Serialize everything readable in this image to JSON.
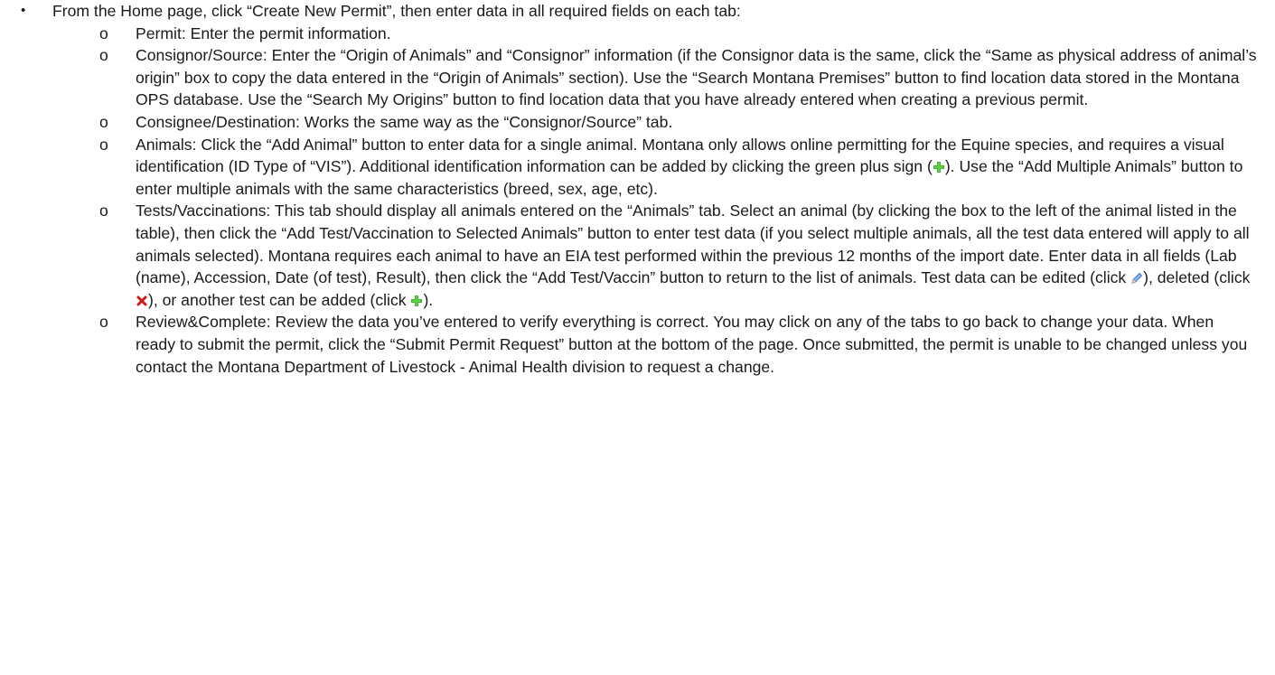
{
  "bullet": {
    "marker": "•",
    "text": "From the Home page, click “Create New Permit”, then enter data in all required fields on each tab:"
  },
  "sub_marker": "o",
  "items": [
    {
      "text": "Permit:  Enter the permit information."
    },
    {
      "text": "Consignor/Source:  Enter the “Origin of Animals” and “Consignor” information (if the Consignor data is the same, click the “Same as physical address of animal’s origin” box to copy the data entered in the “Origin of Animals” section).  Use the “Search Montana Premises” button to find location data stored in the Montana OPS database.  Use the “Search My Origins” button to find location data that you have already entered when creating a previous permit."
    },
    {
      "text": "Consignee/Destination:  Works the same way as the “Consignor/Source” tab."
    },
    {
      "text_a": "Animals:  Click the “Add Animal” button to enter data for a single animal.  Montana only allows online permitting for the Equine species, and requires a visual identification (ID Type of “VIS”).  Additional identification information can be added by clicking the green plus sign (",
      "text_b": ").  Use the “Add Multiple Animals” button to enter multiple animals with the same characteristics (breed, sex, age, etc)."
    },
    {
      "text_a": "Tests/Vaccinations:  This tab should display all animals entered on the “Animals” tab.  Select an animal (by clicking the box to the left of the animal listed in the table), then click the “Add Test/Vaccination to Selected Animals” button to enter test data (if you select multiple animals, all the test data entered will apply to all animals selected).  Montana requires each animal to have an EIA test performed within the previous 12 months of the import date.  Enter data in all fields (Lab (name), Accession, Date (of test), Result), then click the “Add Test/Vaccin” button to return to the list of animals.  Test data can be edited (click ",
      "text_b": "), deleted (click ",
      "text_c": "), or another test can be added (click ",
      "text_d": ")."
    },
    {
      "text": "Review&Complete:  Review the data you’ve entered to verify everything is correct.  You may click on any of the tabs to go back to change your data.  When ready to submit the permit, click the “Submit Permit Request” button at the bottom of the page.  Once submitted, the permit is unable to be changed unless you contact the Montana Department of Livestock - Animal Health division to request a change."
    }
  ],
  "icons": {
    "plus_color": "#3fae2a",
    "delete_color": "#d01818",
    "edit_color": "#4a78c8"
  }
}
